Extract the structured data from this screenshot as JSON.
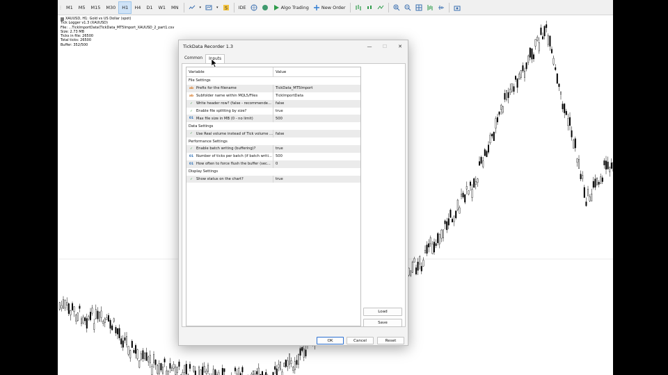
{
  "toolbar": {
    "timeframes": [
      "M1",
      "M5",
      "M15",
      "M30",
      "H1",
      "H4",
      "D1",
      "W1",
      "MN"
    ],
    "active_timeframe": "H1",
    "ide_label": "IDE",
    "algo_label": "Algo Trading",
    "new_order_label": "New Order"
  },
  "chart_info": {
    "symbol_line": "XAUUSD, H1:  Gold vs US Dollar (spot)",
    "lines": [
      "Tick Logger v1.3 (XAUUSD)",
      "File: ...TickImportData\\TickData_MT5Import_XAUUSD_2_part1.csv",
      "Size: 2.73 MB",
      "Ticks in file: 26500",
      "Total ticks: 26500",
      "Buffer: 352/500"
    ]
  },
  "dialog": {
    "title": "TickData Recorder 1.3",
    "tabs": [
      "Common",
      "Inputs"
    ],
    "selected_tab": "Inputs",
    "columns": {
      "variable": "Variable",
      "value": "Value"
    },
    "rows": [
      {
        "kind": "group",
        "label": "File Settings"
      },
      {
        "kind": "param",
        "icon": "ab",
        "name": "Prefix for the filename",
        "value": "TickData_MT5Import"
      },
      {
        "kind": "param",
        "icon": "ab",
        "name": "Subfolder name within MQL5/Files",
        "value": "TickImportData"
      },
      {
        "kind": "param",
        "icon": "bool",
        "name": "Write header row? (false - recommende...",
        "value": "false"
      },
      {
        "kind": "param",
        "icon": "bool",
        "name": "Enable file splitting by size?",
        "value": "true"
      },
      {
        "kind": "param",
        "icon": "num",
        "name": "Max file size in MB (0 - no limit)",
        "value": "500"
      },
      {
        "kind": "group",
        "label": "Data Settings"
      },
      {
        "kind": "param",
        "icon": "bool",
        "name": "Use Real volume instead of Tick volume ...",
        "value": "false"
      },
      {
        "kind": "group",
        "label": "Performance Settings"
      },
      {
        "kind": "param",
        "icon": "bool",
        "name": "Enable batch writing (buffering)?",
        "value": "true"
      },
      {
        "kind": "param",
        "icon": "num",
        "name": "Number of ticks per batch (if batch writi...",
        "value": "500"
      },
      {
        "kind": "param",
        "icon": "num",
        "name": "How often to force flush the buffer (sec...",
        "value": "0"
      },
      {
        "kind": "group",
        "label": "Display Settings"
      },
      {
        "kind": "param",
        "icon": "bool",
        "name": "Show status on the chart?",
        "value": "true"
      }
    ],
    "side_buttons": {
      "load": "Load",
      "save": "Save"
    },
    "buttons": {
      "ok": "OK",
      "cancel": "Cancel",
      "reset": "Reset"
    }
  }
}
